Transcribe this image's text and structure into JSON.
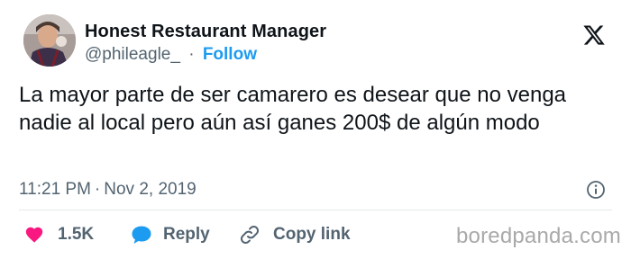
{
  "author": {
    "name": "Honest Restaurant Manager",
    "handle": "@phileagle_",
    "separator": "·",
    "follow_label": "Follow"
  },
  "platform_icon": "x-logo-icon",
  "tweet": {
    "text": "La mayor parte de ser camarero es desear que no venga nadie al local pero aún así ganes 200$ de algún modo",
    "time": "11:21 PM",
    "separator": "·",
    "date": "Nov 2, 2019"
  },
  "actions": {
    "likes": {
      "icon": "heart-icon",
      "count": "1.5K",
      "color": "#f91880"
    },
    "reply": {
      "icon": "comment-bubble-icon",
      "label": "Reply",
      "color": "#1d9bf0"
    },
    "copy_link": {
      "icon": "link-icon",
      "label": "Copy link"
    }
  },
  "watermark": "boredpanda.com",
  "colors": {
    "accent": "#1d9bf0",
    "text_primary": "#0f1419",
    "text_secondary": "#536471",
    "like": "#f91880"
  }
}
